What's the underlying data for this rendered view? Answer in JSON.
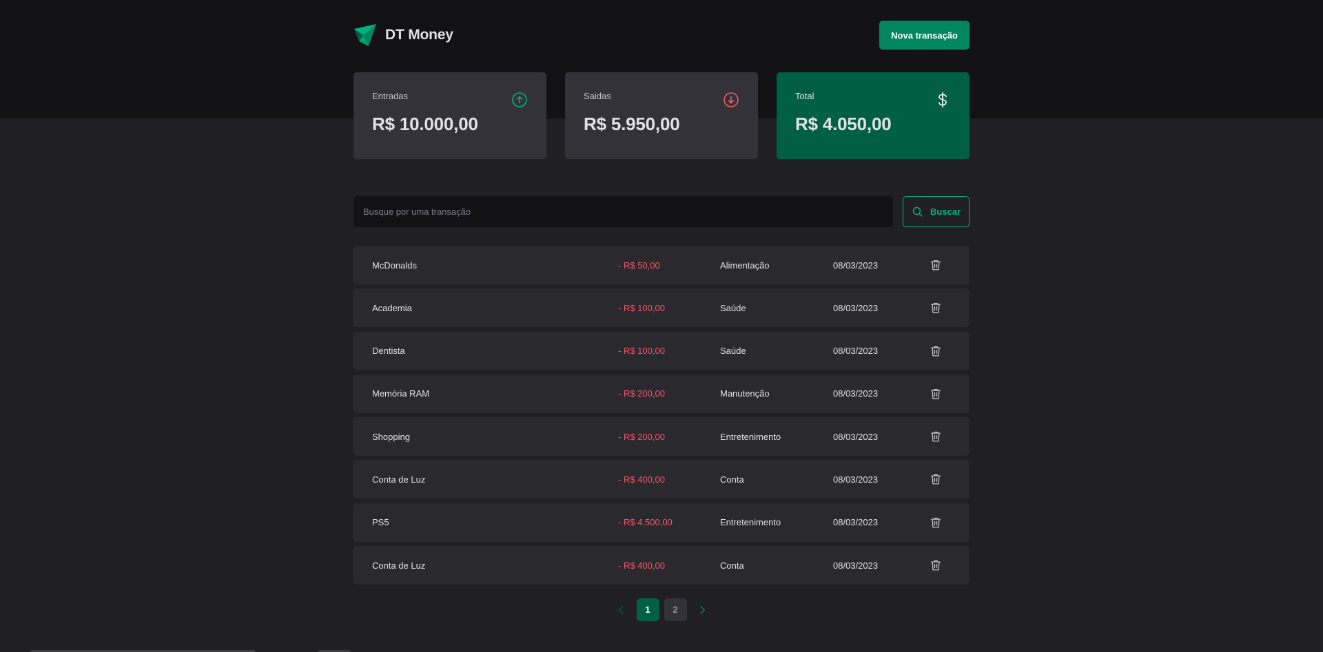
{
  "colors": {
    "accent": "#00875f",
    "accent_light": "#00b37e",
    "accent_dark": "#015f43",
    "danger": "#f75a68",
    "background": "#202024",
    "header_bg": "#121214",
    "card_bg": "#323238",
    "row_bg": "#29292e"
  },
  "header": {
    "logo_icon": "dt-money-logo-icon",
    "brand": "DT Money",
    "new_transaction_label": "Nova transação"
  },
  "summary": {
    "income": {
      "label": "Entradas",
      "value": "R$ 10.000,00",
      "icon": "arrow-circle-up-icon"
    },
    "outcome": {
      "label": "Saidas",
      "value": "R$ 5.950,00",
      "icon": "arrow-circle-down-icon"
    },
    "total": {
      "label": "Total",
      "value": "R$ 4.050,00",
      "icon": "currency-dollar-icon"
    }
  },
  "search": {
    "placeholder": "Busque por uma transação",
    "value": "",
    "button_label": "Buscar",
    "button_icon": "magnifying-glass-icon"
  },
  "transactions": [
    {
      "description": "McDonalds",
      "price": "- R$ 50,00",
      "category": "Alimentação",
      "date": "08/03/2023"
    },
    {
      "description": "Academia",
      "price": "- R$ 100,00",
      "category": "Saúde",
      "date": "08/03/2023"
    },
    {
      "description": "Dentista",
      "price": "- R$ 100,00",
      "category": "Saúde",
      "date": "08/03/2023"
    },
    {
      "description": "Memória RAM",
      "price": "- R$ 200,00",
      "category": "Manutenção",
      "date": "08/03/2023"
    },
    {
      "description": "Shopping",
      "price": "- R$ 200,00",
      "category": "Entretenimento",
      "date": "08/03/2023"
    },
    {
      "description": "Conta de Luz",
      "price": "- R$ 400,00",
      "category": "Conta",
      "date": "08/03/2023"
    },
    {
      "description": "PS5",
      "price": "- R$ 4.500,00",
      "category": "Entretenimento",
      "date": "08/03/2023"
    },
    {
      "description": "Conta de Luz",
      "price": "- R$ 400,00",
      "category": "Conta",
      "date": "08/03/2023"
    }
  ],
  "row_delete_icon": "trash-icon",
  "pagination": {
    "prev_icon": "caret-left-icon",
    "next_icon": "caret-right-icon",
    "pages": [
      "1",
      "2"
    ],
    "current": "1"
  }
}
